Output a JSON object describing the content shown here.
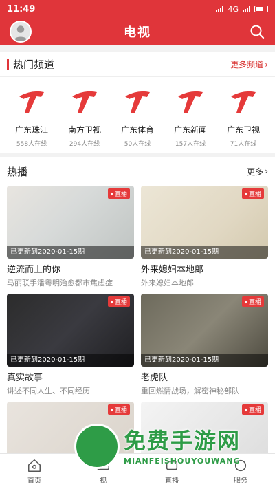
{
  "status_bar": {
    "time": "11:49",
    "net": "4G"
  },
  "header": {
    "title": "电视"
  },
  "hot_channels": {
    "heading": "热门频道",
    "more": "更多频道",
    "items": [
      {
        "name": "广东珠江",
        "online": "558人在线"
      },
      {
        "name": "南方卫视",
        "online": "294人在线"
      },
      {
        "name": "广东体育",
        "online": "50人在线"
      },
      {
        "name": "广东新闻",
        "online": "157人在线"
      },
      {
        "name": "广东卫视",
        "online": "71人在线"
      }
    ]
  },
  "hot_play": {
    "heading": "热播",
    "more": "更多",
    "live_label": "直播",
    "items": [
      {
        "title": "逆流而上的你",
        "desc": "马丽联手潘粤明治愈都市焦虑症",
        "update": "已更新到2020-01-15期"
      },
      {
        "title": "外来媳妇本地郎",
        "desc": "外来媳妇本地郎",
        "update": "已更新到2020-01-15期"
      },
      {
        "title": "真实故事",
        "desc": "讲述不同人生、不同经历",
        "update": "已更新到2020-01-15期"
      },
      {
        "title": "老虎队",
        "desc": "重回燃情战场，解密神秘部队",
        "update": "已更新到2020-01-15期"
      },
      {
        "title": "",
        "desc": "",
        "update": ""
      },
      {
        "title": "",
        "desc": "",
        "update": ""
      }
    ]
  },
  "tabbar": {
    "items": [
      {
        "label": "首页"
      },
      {
        "label": "视"
      },
      {
        "label": "直播"
      },
      {
        "label": "服务"
      }
    ]
  },
  "watermark": {
    "text": "免费手游网",
    "sub": "MIANFEISHOUYOUWANG"
  },
  "colors": {
    "brand": "#e0353a"
  }
}
